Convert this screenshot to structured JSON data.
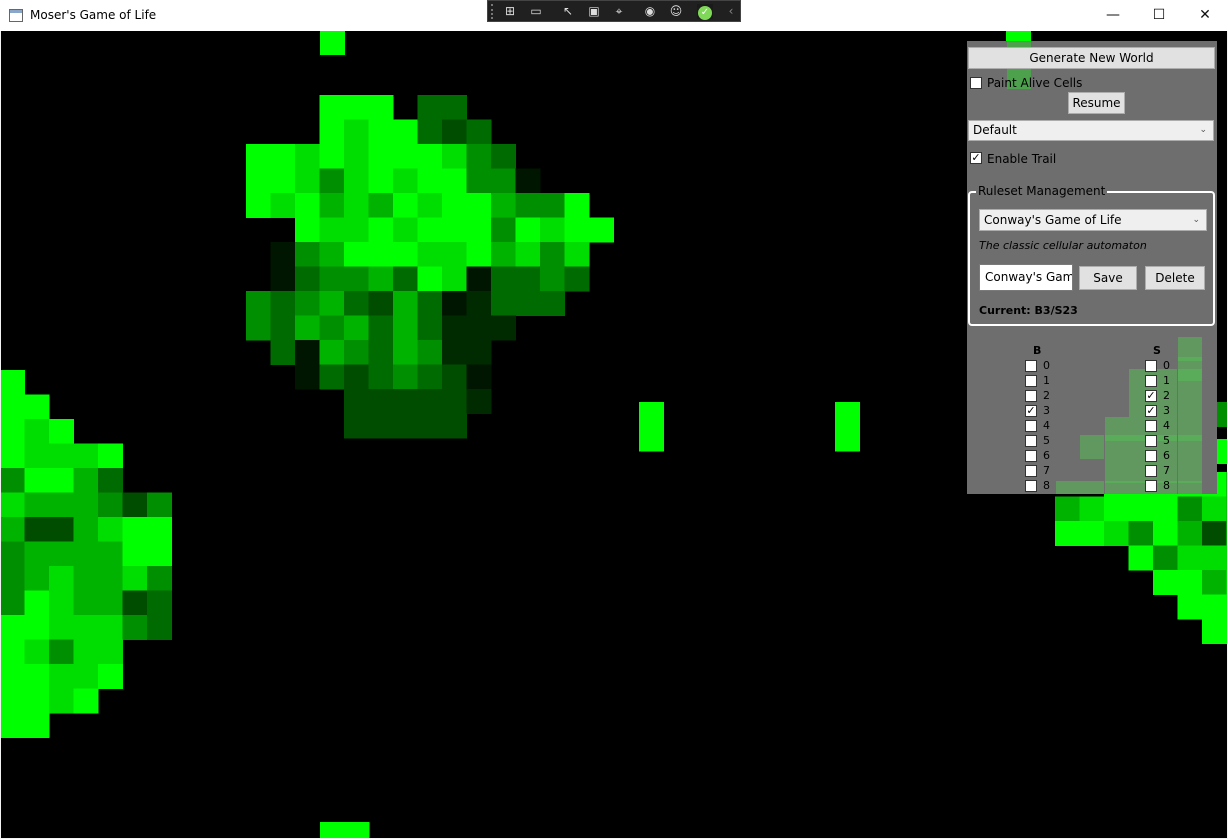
{
  "window": {
    "title": "Moser's Game of Life"
  },
  "controls": {
    "generate_label": "Generate New World",
    "paint_label": "Paint Alive Cells",
    "paint_checked": false,
    "resume_label": "Resume",
    "theme_selected": "Default",
    "trail_label": "Enable Trail",
    "trail_checked": true
  },
  "ruleset": {
    "group_title": "Ruleset Management",
    "selected": "Conway's Game of Life",
    "description": "The classic cellular automaton",
    "name_value": "Conway's Game",
    "save_label": "Save",
    "delete_label": "Delete",
    "current": "Current: B3/S23"
  },
  "rules": {
    "birth_header": "B",
    "survive_header": "S",
    "numbers": [
      "0",
      "1",
      "2",
      "3",
      "4",
      "5",
      "6",
      "7",
      "8"
    ],
    "birth_checked": [
      false,
      false,
      false,
      true,
      false,
      false,
      false,
      false,
      false
    ],
    "survive_checked": [
      false,
      false,
      true,
      true,
      false,
      false,
      false,
      false,
      false
    ]
  }
}
